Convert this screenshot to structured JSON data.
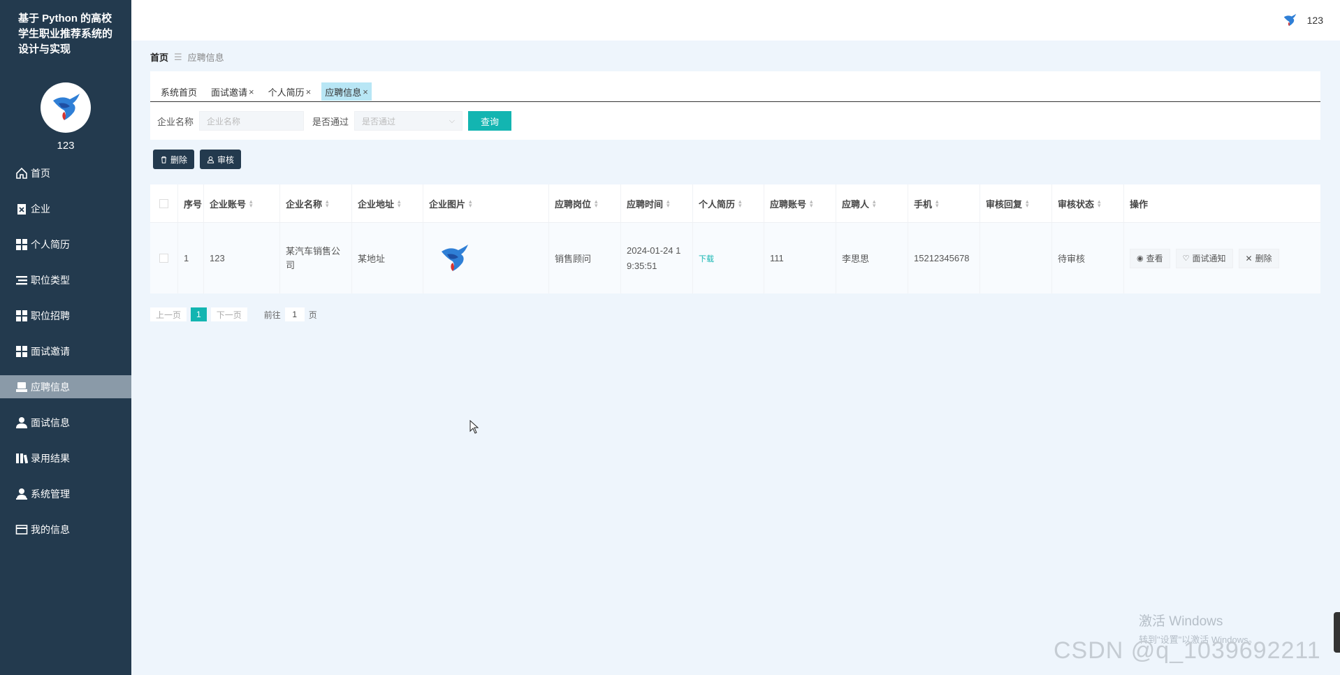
{
  "app": {
    "title": "基于 Python 的高校学生职业推荐系统的设计与实现",
    "username": "123"
  },
  "sidebar": {
    "items": [
      {
        "label": "首页",
        "icon": "home-icon"
      },
      {
        "label": "企业",
        "icon": "clipboard-x-icon"
      },
      {
        "label": "个人简历",
        "icon": "grid-icon"
      },
      {
        "label": "职位类型",
        "icon": "list-icon"
      },
      {
        "label": "职位招聘",
        "icon": "grid-icon"
      },
      {
        "label": "面试邀请",
        "icon": "grid-icon"
      },
      {
        "label": "应聘信息",
        "icon": "inbox-icon",
        "active": true
      },
      {
        "label": "面试信息",
        "icon": "user-icon"
      },
      {
        "label": "录用结果",
        "icon": "book-icon"
      },
      {
        "label": "系统管理",
        "icon": "user-cog-icon"
      },
      {
        "label": "我的信息",
        "icon": "card-icon"
      }
    ]
  },
  "header": {
    "username": "123"
  },
  "breadcrumb": {
    "home": "首页",
    "separator": "☰",
    "current": "应聘信息"
  },
  "tabs": [
    {
      "label": "系统首页",
      "closable": false
    },
    {
      "label": "面试邀请",
      "closable": true
    },
    {
      "label": "个人简历",
      "closable": true
    },
    {
      "label": "应聘信息",
      "closable": true,
      "active": true
    }
  ],
  "filters": {
    "company_label": "企业名称",
    "company_placeholder": "企业名称",
    "passed_label": "是否通过",
    "passed_placeholder": "是否通过",
    "query_button": "查询"
  },
  "actions": {
    "delete": "删除",
    "audit": "审核"
  },
  "table": {
    "columns": [
      "序号",
      "企业账号",
      "企业名称",
      "企业地址",
      "企业图片",
      "应聘岗位",
      "应聘时间",
      "个人简历",
      "应聘账号",
      "应聘人",
      "手机",
      "审核回复",
      "审核状态",
      "操作"
    ],
    "rows": [
      {
        "index": "1",
        "company_account": "123",
        "company_name": "某汽车销售公司",
        "company_address": "某地址",
        "position": "销售顾问",
        "apply_time": "2024-01-24 19:35:51",
        "resume": "下载",
        "apply_account": "111",
        "applicant": "李思思",
        "phone": "15212345678",
        "audit_reply": "",
        "audit_status": "待审核",
        "ops": {
          "view": "查看",
          "notify": "面试通知",
          "delete": "删除"
        }
      }
    ]
  },
  "pagination": {
    "prev": "上一页",
    "current": "1",
    "next": "下一页",
    "goto_label": "前往",
    "goto_value": "1",
    "page_suffix": "页"
  },
  "watermarks": {
    "windows_title": "激活 Windows",
    "windows_sub": "转到\"设置\"以激活 Windows。",
    "csdn": "CSDN @q_1039692211"
  },
  "colors": {
    "sidebar_bg": "#233a4e",
    "accent": "#13b5b1",
    "active_tab": "#b8e6f5",
    "page_bg": "#eef5fc"
  }
}
